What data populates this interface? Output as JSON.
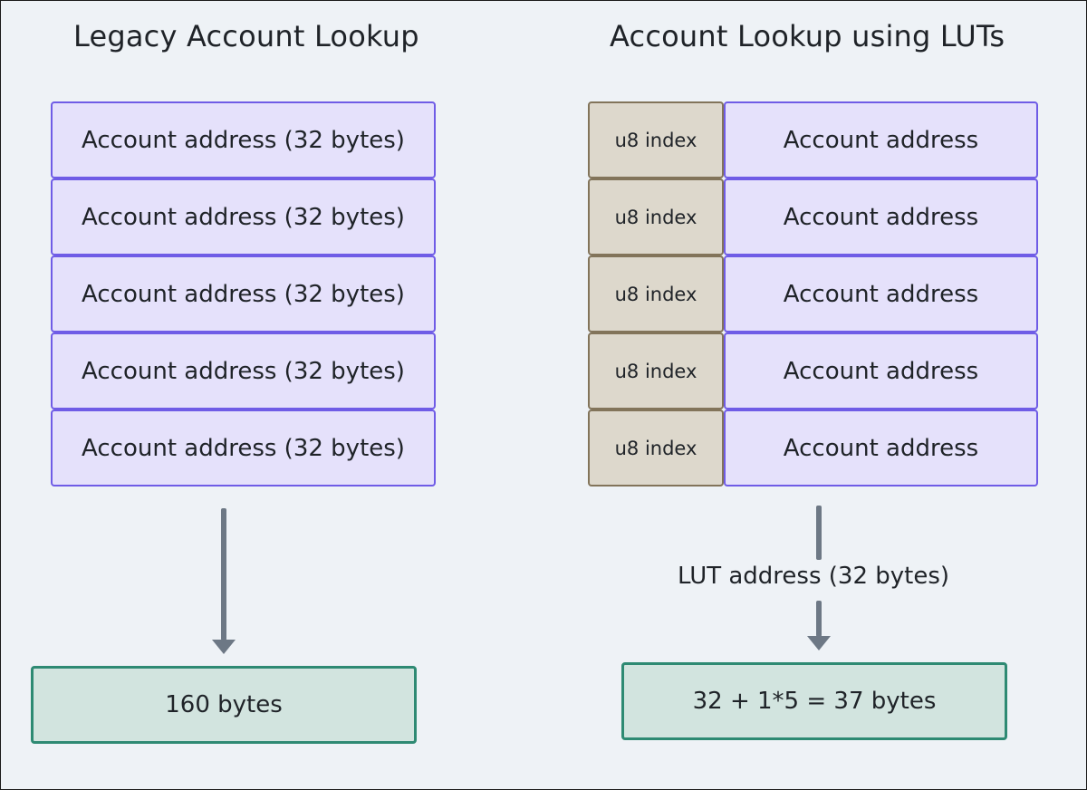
{
  "legacy": {
    "title": "Legacy Account Lookup",
    "rows": [
      "Account address (32 bytes)",
      "Account address (32 bytes)",
      "Account address (32 bytes)",
      "Account address (32 bytes)",
      "Account address (32 bytes)"
    ],
    "result": "160 bytes"
  },
  "lut": {
    "title": "Account Lookup using LUTs",
    "rows": [
      {
        "index": "u8 index",
        "address": "Account address"
      },
      {
        "index": "u8 index",
        "address": "Account address"
      },
      {
        "index": "u8 index",
        "address": "Account address"
      },
      {
        "index": "u8 index",
        "address": "Account address"
      },
      {
        "index": "u8 index",
        "address": "Account address"
      }
    ],
    "arrow_label": "LUT address (32 bytes)",
    "result": "32 + 1*5 = 37 bytes"
  }
}
